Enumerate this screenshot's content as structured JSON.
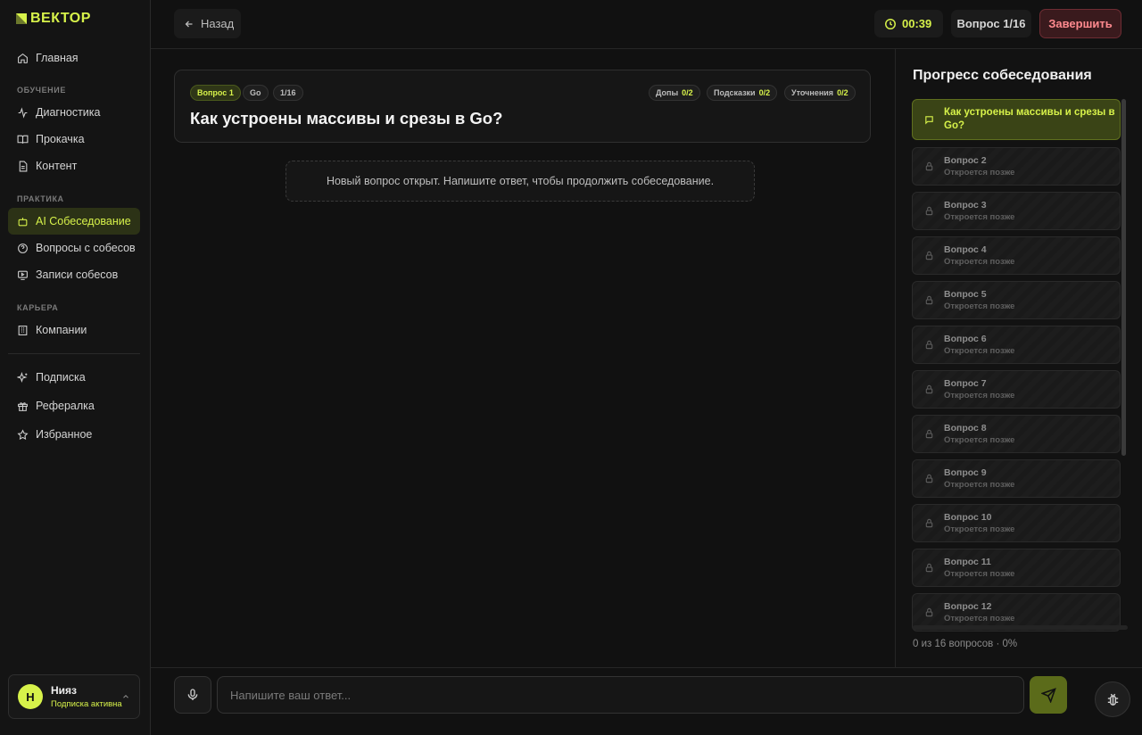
{
  "app": {
    "logo_text": "ВЕКТОР"
  },
  "sidebar": {
    "items": [
      {
        "label": "Главная",
        "icon": "home-icon"
      },
      {
        "label": "Диагностика",
        "icon": "pulse-icon"
      },
      {
        "label": "Прокачка",
        "icon": "book-icon"
      },
      {
        "label": "Контент",
        "icon": "document-icon"
      },
      {
        "label": "AI Собеседование",
        "icon": "robot-icon",
        "active": true
      },
      {
        "label": "Вопросы с собесов",
        "icon": "help-circle-icon"
      },
      {
        "label": "Записи собесов",
        "icon": "video-icon"
      },
      {
        "label": "Компании",
        "icon": "building-icon"
      },
      {
        "label": "Подписка",
        "icon": "sparkles-icon"
      },
      {
        "label": "Рефералка",
        "icon": "gift-icon"
      },
      {
        "label": "Избранное",
        "icon": "star-icon"
      }
    ],
    "sections": {
      "learning": "ОБУЧЕНИЕ",
      "practice": "ПРАКТИКА",
      "career": "КАРЬЕРА"
    },
    "user": {
      "initial": "Н",
      "name": "Нияз",
      "status": "Подписка активна"
    }
  },
  "topbar": {
    "back_label": "Назад",
    "timer": "00:39",
    "question_counter": "Вопрос 1/16",
    "finish_label": "Завершить"
  },
  "question": {
    "chips": {
      "number": "Вопрос 1",
      "topic": "Go",
      "position": "1/16"
    },
    "stats": {
      "extras_label": "Допы",
      "extras_value": "0/2",
      "hints_label": "Подсказки",
      "hints_value": "0/2",
      "clarifications_label": "Уточнения",
      "clarifications_value": "0/2"
    },
    "title": "Как устроены массивы и срезы в Go?",
    "notice": "Новый вопрос открыт. Напишите ответ, чтобы продолжить собеседование."
  },
  "progress": {
    "title": "Прогресс собеседования",
    "current": "Как устроены массивы и срезы в Go?",
    "locked_sub": "Откроется позже",
    "items": [
      "Вопрос 2",
      "Вопрос 3",
      "Вопрос 4",
      "Вопрос 5",
      "Вопрос 6",
      "Вопрос 7",
      "Вопрос 8",
      "Вопрос 9",
      "Вопрос 10",
      "Вопрос 11",
      "Вопрос 12"
    ],
    "footer": "0 из 16 вопросов · 0%",
    "percent": 0
  },
  "composer": {
    "placeholder": "Напишите ваш ответ..."
  },
  "colors": {
    "accent": "#d7f24a",
    "danger": "#ff8a8f",
    "background": "#111111"
  }
}
